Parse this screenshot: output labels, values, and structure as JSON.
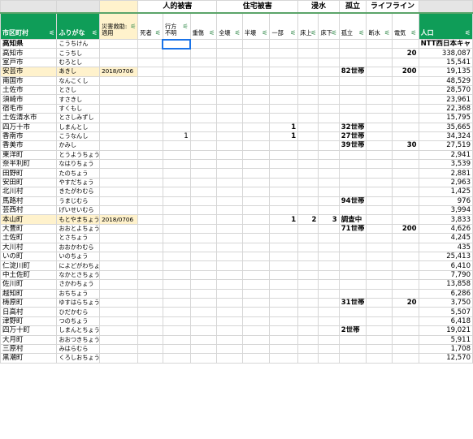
{
  "groups": {
    "human": "人的被害",
    "housing": "住宅被害",
    "flood": "浸水",
    "isolation": "孤立",
    "lifeline": "ライフライン"
  },
  "headers": {
    "city": "市区町村",
    "furigana": "ふりがな",
    "disaster_law": "災害救助:\n適用",
    "deaths": "死者",
    "missing": "行方不明",
    "injured": "重傷",
    "full_destroyed": "全壊",
    "half_destroyed": "半壊",
    "partial": "一部",
    "above_floor": "床上",
    "below_floor": "床下",
    "isolated": "孤立",
    "water_outage": "断水",
    "power_outage": "電気",
    "population": "人口"
  },
  "filter_icon": "filter-icon",
  "rows": [
    {
      "city": "高知県",
      "kana": "こうちけん",
      "date": "",
      "deaths": "",
      "missing": "",
      "injured": "",
      "full": "",
      "half": "",
      "partial": "",
      "above": "",
      "below": "",
      "isolated": "",
      "water": "",
      "power": "",
      "pop": "NTT西日本キャ",
      "hl": false,
      "bold": true
    },
    {
      "city": "高知市",
      "kana": "こうちし",
      "date": "",
      "deaths": "",
      "missing": "",
      "injured": "",
      "full": "",
      "half": "",
      "partial": "",
      "above": "",
      "below": "",
      "isolated": "",
      "water": "",
      "power": "20",
      "pop": "338,087",
      "hl": false,
      "bold": false
    },
    {
      "city": "室戸市",
      "kana": "むろとし",
      "date": "",
      "deaths": "",
      "missing": "",
      "injured": "",
      "full": "",
      "half": "",
      "partial": "",
      "above": "",
      "below": "",
      "isolated": "",
      "water": "",
      "power": "",
      "pop": "15,541",
      "hl": false,
      "bold": false
    },
    {
      "city": "安芸市",
      "kana": "あきし",
      "date": "2018/0706",
      "deaths": "",
      "missing": "",
      "injured": "",
      "full": "",
      "half": "",
      "partial": "",
      "above": "",
      "below": "",
      "isolated": "82世帯",
      "water": "",
      "power": "200",
      "pop": "19,135",
      "hl": true,
      "bold": false
    },
    {
      "city": "南国市",
      "kana": "なんこくし",
      "date": "",
      "deaths": "",
      "missing": "",
      "injured": "",
      "full": "",
      "half": "",
      "partial": "",
      "above": "",
      "below": "",
      "isolated": "",
      "water": "",
      "power": "",
      "pop": "48,529",
      "hl": false,
      "bold": false
    },
    {
      "city": "土佐市",
      "kana": "とさし",
      "date": "",
      "deaths": "",
      "missing": "",
      "injured": "",
      "full": "",
      "half": "",
      "partial": "",
      "above": "",
      "below": "",
      "isolated": "",
      "water": "",
      "power": "",
      "pop": "28,570",
      "hl": false,
      "bold": false
    },
    {
      "city": "須崎市",
      "kana": "すさきし",
      "date": "",
      "deaths": "",
      "missing": "",
      "injured": "",
      "full": "",
      "half": "",
      "partial": "",
      "above": "",
      "below": "",
      "isolated": "",
      "water": "",
      "power": "",
      "pop": "23,961",
      "hl": false,
      "bold": false
    },
    {
      "city": "宿毛市",
      "kana": "すくもし",
      "date": "",
      "deaths": "",
      "missing": "",
      "injured": "",
      "full": "",
      "half": "",
      "partial": "",
      "above": "",
      "below": "",
      "isolated": "",
      "water": "",
      "power": "",
      "pop": "22,368",
      "hl": false,
      "bold": false
    },
    {
      "city": "土佐清水市",
      "kana": "とさしみずし",
      "date": "",
      "deaths": "",
      "missing": "",
      "injured": "",
      "full": "",
      "half": "",
      "partial": "",
      "above": "",
      "below": "",
      "isolated": "",
      "water": "",
      "power": "",
      "pop": "15,795",
      "hl": false,
      "bold": false
    },
    {
      "city": "四万十市",
      "kana": "しまんとし",
      "date": "",
      "deaths": "",
      "missing": "",
      "injured": "",
      "full": "",
      "half": "",
      "partial": "1",
      "above": "",
      "below": "",
      "isolated": "32世帯",
      "water": "",
      "power": "",
      "pop": "35,665",
      "hl": false,
      "bold": false
    },
    {
      "city": "香南市",
      "kana": "こうなんし",
      "date": "",
      "deaths": "",
      "missing": "1",
      "injured": "",
      "full": "",
      "half": "",
      "partial": "1",
      "above": "",
      "below": "",
      "isolated": "27世帯",
      "water": "",
      "power": "",
      "pop": "34,324",
      "hl": false,
      "bold": false
    },
    {
      "city": "香美市",
      "kana": "かみし",
      "date": "",
      "deaths": "",
      "missing": "",
      "injured": "",
      "full": "",
      "half": "",
      "partial": "",
      "above": "",
      "below": "",
      "isolated": "39世帯",
      "water": "",
      "power": "30",
      "pop": "27,519",
      "hl": false,
      "bold": false
    },
    {
      "city": "東洋町",
      "kana": "とうようちょう",
      "date": "",
      "deaths": "",
      "missing": "",
      "injured": "",
      "full": "",
      "half": "",
      "partial": "",
      "above": "",
      "below": "",
      "isolated": "",
      "water": "",
      "power": "",
      "pop": "2,941",
      "hl": false,
      "bold": false
    },
    {
      "city": "奈半利町",
      "kana": "なはりちょう",
      "date": "",
      "deaths": "",
      "missing": "",
      "injured": "",
      "full": "",
      "half": "",
      "partial": "",
      "above": "",
      "below": "",
      "isolated": "",
      "water": "",
      "power": "",
      "pop": "3,539",
      "hl": false,
      "bold": false
    },
    {
      "city": "田野町",
      "kana": "たのちょう",
      "date": "",
      "deaths": "",
      "missing": "",
      "injured": "",
      "full": "",
      "half": "",
      "partial": "",
      "above": "",
      "below": "",
      "isolated": "",
      "water": "",
      "power": "",
      "pop": "2,881",
      "hl": false,
      "bold": false
    },
    {
      "city": "安田町",
      "kana": "やすだちょう",
      "date": "",
      "deaths": "",
      "missing": "",
      "injured": "",
      "full": "",
      "half": "",
      "partial": "",
      "above": "",
      "below": "",
      "isolated": "",
      "water": "",
      "power": "",
      "pop": "2,963",
      "hl": false,
      "bold": false
    },
    {
      "city": "北川村",
      "kana": "きたがわむら",
      "date": "",
      "deaths": "",
      "missing": "",
      "injured": "",
      "full": "",
      "half": "",
      "partial": "",
      "above": "",
      "below": "",
      "isolated": "",
      "water": "",
      "power": "",
      "pop": "1,425",
      "hl": false,
      "bold": false
    },
    {
      "city": "馬路村",
      "kana": "うまじむら",
      "date": "",
      "deaths": "",
      "missing": "",
      "injured": "",
      "full": "",
      "half": "",
      "partial": "",
      "above": "",
      "below": "",
      "isolated": "94世帯",
      "water": "",
      "power": "",
      "pop": "976",
      "hl": false,
      "bold": false
    },
    {
      "city": "芸西村",
      "kana": "げいせいむら",
      "date": "",
      "deaths": "",
      "missing": "",
      "injured": "",
      "full": "",
      "half": "",
      "partial": "",
      "above": "",
      "below": "",
      "isolated": "",
      "water": "",
      "power": "",
      "pop": "3,994",
      "hl": false,
      "bold": false
    },
    {
      "city": "本山町",
      "kana": "もとやまちょう",
      "date": "2018/0706",
      "deaths": "",
      "missing": "",
      "injured": "",
      "full": "",
      "half": "",
      "partial": "1",
      "above": "2",
      "below": "3",
      "isolated": "調査中",
      "water": "",
      "power": "",
      "pop": "3,833",
      "hl": true,
      "bold": false
    },
    {
      "city": "大豊町",
      "kana": "おおとよちょう",
      "date": "",
      "deaths": "",
      "missing": "",
      "injured": "",
      "full": "",
      "half": "",
      "partial": "",
      "above": "",
      "below": "",
      "isolated": "71世帯",
      "water": "",
      "power": "200",
      "pop": "4,626",
      "hl": false,
      "bold": false
    },
    {
      "city": "土佐町",
      "kana": "とさちょう",
      "date": "",
      "deaths": "",
      "missing": "",
      "injured": "",
      "full": "",
      "half": "",
      "partial": "",
      "above": "",
      "below": "",
      "isolated": "",
      "water": "",
      "power": "",
      "pop": "4,245",
      "hl": false,
      "bold": false
    },
    {
      "city": "大川村",
      "kana": "おおかわむら",
      "date": "",
      "deaths": "",
      "missing": "",
      "injured": "",
      "full": "",
      "half": "",
      "partial": "",
      "above": "",
      "below": "",
      "isolated": "",
      "water": "",
      "power": "",
      "pop": "435",
      "hl": false,
      "bold": false
    },
    {
      "city": "いの町",
      "kana": "いのちょう",
      "date": "",
      "deaths": "",
      "missing": "",
      "injured": "",
      "full": "",
      "half": "",
      "partial": "",
      "above": "",
      "below": "",
      "isolated": "",
      "water": "",
      "power": "",
      "pop": "25,413",
      "hl": false,
      "bold": false
    },
    {
      "city": "仁淀川町",
      "kana": "によどがわちょう",
      "date": "",
      "deaths": "",
      "missing": "",
      "injured": "",
      "full": "",
      "half": "",
      "partial": "",
      "above": "",
      "below": "",
      "isolated": "",
      "water": "",
      "power": "",
      "pop": "6,410",
      "hl": false,
      "bold": false
    },
    {
      "city": "中土佐町",
      "kana": "なかとさちょう",
      "date": "",
      "deaths": "",
      "missing": "",
      "injured": "",
      "full": "",
      "half": "",
      "partial": "",
      "above": "",
      "below": "",
      "isolated": "",
      "water": "",
      "power": "",
      "pop": "7,790",
      "hl": false,
      "bold": false
    },
    {
      "city": "佐川町",
      "kana": "さかわちょう",
      "date": "",
      "deaths": "",
      "missing": "",
      "injured": "",
      "full": "",
      "half": "",
      "partial": "",
      "above": "",
      "below": "",
      "isolated": "",
      "water": "",
      "power": "",
      "pop": "13,858",
      "hl": false,
      "bold": false
    },
    {
      "city": "越知町",
      "kana": "おちちょう",
      "date": "",
      "deaths": "",
      "missing": "",
      "injured": "",
      "full": "",
      "half": "",
      "partial": "",
      "above": "",
      "below": "",
      "isolated": "",
      "water": "",
      "power": "",
      "pop": "6,286",
      "hl": false,
      "bold": false
    },
    {
      "city": "梼原町",
      "kana": "ゆすはらちょう",
      "date": "",
      "deaths": "",
      "missing": "",
      "injured": "",
      "full": "",
      "half": "",
      "partial": "",
      "above": "",
      "below": "",
      "isolated": "31世帯",
      "water": "",
      "power": "20",
      "pop": "3,750",
      "hl": false,
      "bold": false
    },
    {
      "city": "日高村",
      "kana": "ひだかむら",
      "date": "",
      "deaths": "",
      "missing": "",
      "injured": "",
      "full": "",
      "half": "",
      "partial": "",
      "above": "",
      "below": "",
      "isolated": "",
      "water": "",
      "power": "",
      "pop": "5,507",
      "hl": false,
      "bold": false
    },
    {
      "city": "津野町",
      "kana": "つのちょう",
      "date": "",
      "deaths": "",
      "missing": "",
      "injured": "",
      "full": "",
      "half": "",
      "partial": "",
      "above": "",
      "below": "",
      "isolated": "",
      "water": "",
      "power": "",
      "pop": "6,418",
      "hl": false,
      "bold": false
    },
    {
      "city": "四万十町",
      "kana": "しまんとちょう",
      "date": "",
      "deaths": "",
      "missing": "",
      "injured": "",
      "full": "",
      "half": "",
      "partial": "",
      "above": "",
      "below": "",
      "isolated": "2世帯",
      "water": "",
      "power": "",
      "pop": "19,021",
      "hl": false,
      "bold": false
    },
    {
      "city": "大月町",
      "kana": "おおつきちょう",
      "date": "",
      "deaths": "",
      "missing": "",
      "injured": "",
      "full": "",
      "half": "",
      "partial": "",
      "above": "",
      "below": "",
      "isolated": "",
      "water": "",
      "power": "",
      "pop": "5,911",
      "hl": false,
      "bold": false
    },
    {
      "city": "三原村",
      "kana": "みはらむら",
      "date": "",
      "deaths": "",
      "missing": "",
      "injured": "",
      "full": "",
      "half": "",
      "partial": "",
      "above": "",
      "below": "",
      "isolated": "",
      "water": "",
      "power": "",
      "pop": "1,708",
      "hl": false,
      "bold": false
    },
    {
      "city": "黒潮町",
      "kana": "くろしおちょう",
      "date": "",
      "deaths": "",
      "missing": "",
      "injured": "",
      "full": "",
      "half": "",
      "partial": "",
      "above": "",
      "below": "",
      "isolated": "",
      "water": "",
      "power": "",
      "pop": "12,570",
      "hl": false,
      "bold": false
    }
  ]
}
